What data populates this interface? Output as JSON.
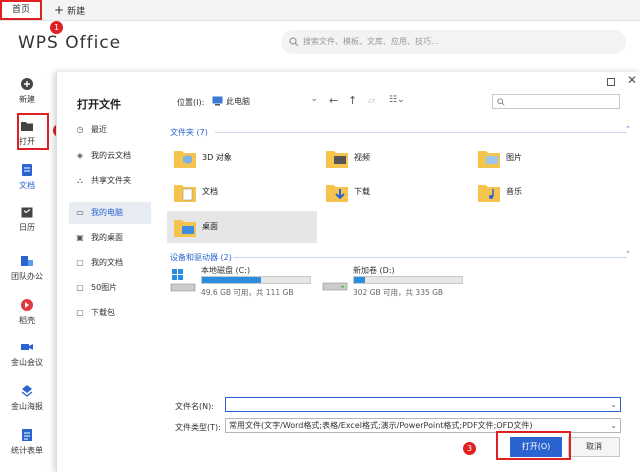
{
  "tabs": {
    "home": "首页",
    "new": "新建"
  },
  "logo": "WPS Office",
  "search_placeholder": "搜索文件、模板、文库、应用、技巧...",
  "sidebar": [
    {
      "label": "新建",
      "icon": "plus-circle-icon"
    },
    {
      "label": "打开",
      "icon": "folder-icon"
    },
    {
      "label": "文档",
      "icon": "document-icon"
    },
    {
      "label": "日历",
      "icon": "calendar-icon"
    },
    {
      "label": "团队办公",
      "icon": "team-icon"
    },
    {
      "label": "稻壳",
      "icon": "docer-icon"
    },
    {
      "label": "金山会议",
      "icon": "meeting-icon"
    },
    {
      "label": "金山海报",
      "icon": "poster-icon"
    },
    {
      "label": "统计表单",
      "icon": "form-icon"
    }
  ],
  "badges": [
    "1",
    "2",
    "3"
  ],
  "dialog": {
    "title": "打开文件",
    "location_label": "位置(I):",
    "location_value": "此电脑",
    "nav": [
      {
        "label": "最近",
        "icon": "clock-icon"
      },
      {
        "label": "我的云文档",
        "icon": "cloud-icon"
      },
      {
        "label": "共享文件夹",
        "icon": "share-icon"
      },
      {
        "label": "我的电脑",
        "icon": "computer-icon"
      },
      {
        "label": "我的桌面",
        "icon": "desktop-icon"
      },
      {
        "label": "我的文档",
        "icon": "documents-icon"
      },
      {
        "label": "50图片",
        "icon": "picture-icon"
      },
      {
        "label": "下载包",
        "icon": "download-icon"
      }
    ],
    "folders_heading": "文件夹 (7)",
    "folders": [
      {
        "label": "3D 对象"
      },
      {
        "label": "视频"
      },
      {
        "label": "图片"
      },
      {
        "label": "文档"
      },
      {
        "label": "下载"
      },
      {
        "label": "音乐"
      },
      {
        "label": "桌面"
      }
    ],
    "drives_heading": "设备和驱动器 (2)",
    "drives": [
      {
        "label": "本地磁盘 (C:)",
        "info": "49.6 GB 可用，共 111 GB",
        "used_fraction": 0.55
      },
      {
        "label": "新加卷 (D:)",
        "info": "302 GB 可用，共 335 GB",
        "used_fraction": 0.1
      }
    ],
    "filename_label": "文件名(N):",
    "filename_value": "",
    "filetype_label": "文件类型(T):",
    "filetype_value": "常用文件(文字/Word格式;表格/Excel格式;演示/PowerPoint格式;PDF文件;OFD文件)",
    "open_button": "打开(O)",
    "cancel_button": "取消"
  },
  "colors": {
    "accent": "#2a64d0",
    "highlight": "#e02020",
    "folder": "#f4c44e"
  }
}
